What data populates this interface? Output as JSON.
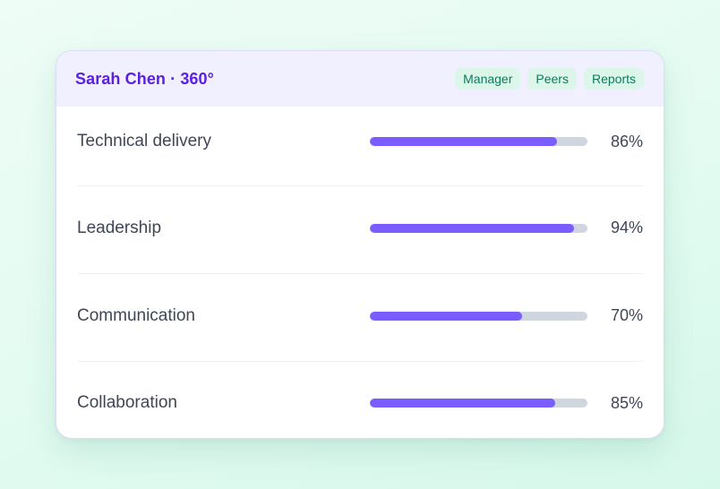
{
  "card": {
    "title": "Sarah Chen · 360°",
    "chips": [
      {
        "label": "Manager"
      },
      {
        "label": "Peers"
      },
      {
        "label": "Reports"
      }
    ]
  },
  "metrics": [
    {
      "label": "Technical delivery",
      "value": 86,
      "display": "86%"
    },
    {
      "label": "Leadership",
      "value": 94,
      "display": "94%"
    },
    {
      "label": "Communication",
      "value": 70,
      "display": "70%"
    },
    {
      "label": "Collaboration",
      "value": 85,
      "display": "85%"
    }
  ],
  "colors": {
    "accent": "#7b5cff",
    "track": "#cfd6de",
    "title": "#5b1fe0",
    "chip_bg": "#dcf6ea",
    "chip_text": "#0f7a5c"
  }
}
